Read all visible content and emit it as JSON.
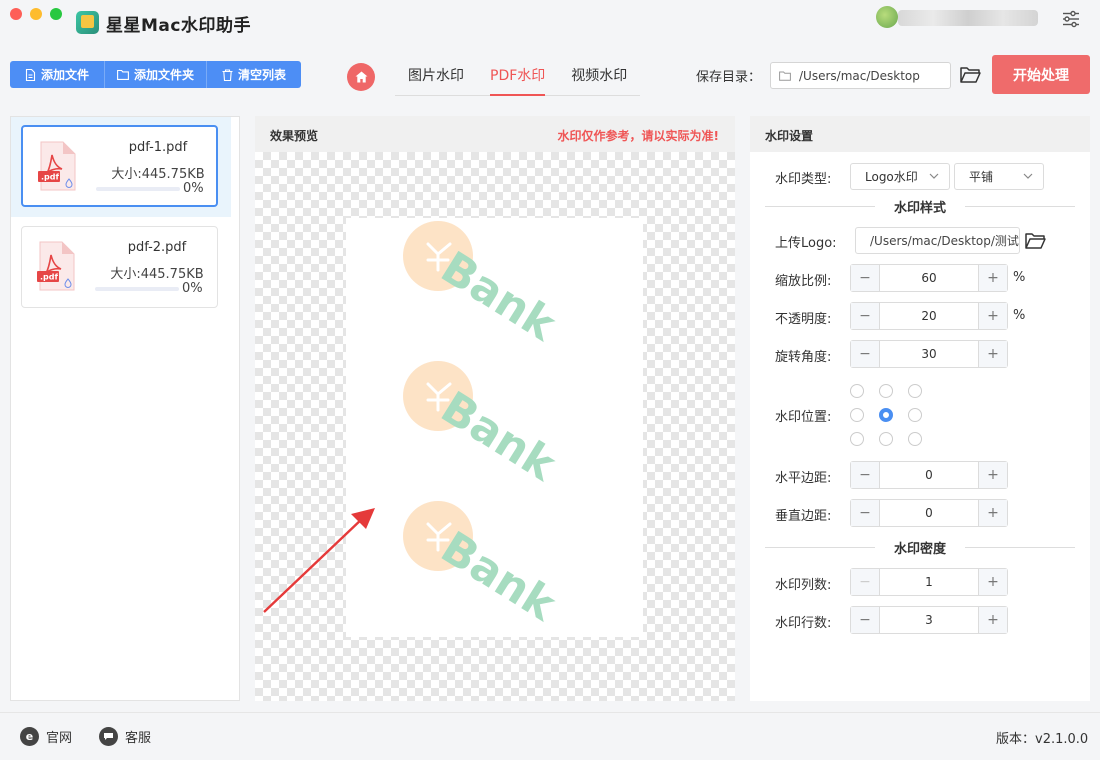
{
  "app": {
    "title": "星星Mac水印助手"
  },
  "toolbar": {
    "add_file": "添加文件",
    "add_folder": "添加文件夹",
    "clear_list": "清空列表",
    "tabs": [
      {
        "label": "图片水印",
        "active": false
      },
      {
        "label": "PDF水印",
        "active": true
      },
      {
        "label": "视频水印",
        "active": false
      }
    ],
    "save_dir_label": "保存目录：",
    "save_dir_value": "/Users/mac/Desktop",
    "start_label": "开始处理"
  },
  "files": [
    {
      "name": "pdf-1.pdf",
      "size": "大小:445.75KB",
      "progress_text": "0%",
      "progress": 0,
      "selected": true
    },
    {
      "name": "pdf-2.pdf",
      "size": "大小:445.75KB",
      "progress_text": "0%",
      "progress": 0,
      "selected": false
    }
  ],
  "preview": {
    "title": "效果预览",
    "note": "水印仅作参考，请以实际为准!",
    "watermark_text": "Bank"
  },
  "settings": {
    "title": "水印设置",
    "type_label": "水印类型:",
    "type_value": "Logo水印",
    "layout_value": "平铺",
    "style_section": "水印样式",
    "upload_logo_label": "上传Logo:",
    "logo_path": "/Users/mac/Desktop/测试",
    "scale_label": "缩放比例:",
    "scale_value": "60",
    "opacity_label": "不透明度:",
    "opacity_value": "20",
    "rotation_label": "旋转角度:",
    "rotation_value": "30",
    "position_label": "水印位置:",
    "position_selected": "center",
    "h_margin_label": "水平边距:",
    "h_margin_value": "0",
    "v_margin_label": "垂直边距:",
    "v_margin_value": "0",
    "density_section": "水印密度",
    "columns_label": "水印列数:",
    "columns_value": "1",
    "rows_label": "水印行数:",
    "rows_value": "3",
    "percent_unit": "%",
    "minus": "−",
    "plus": "+"
  },
  "footer": {
    "website": "官网",
    "support": "客服",
    "version": "版本：v2.1.0.0"
  },
  "colors": {
    "primary_blue": "#4d8ef5",
    "accent_red": "#ef6b6b",
    "watermark_green": "#a7dcc0",
    "watermark_orange": "#fde3c6"
  }
}
